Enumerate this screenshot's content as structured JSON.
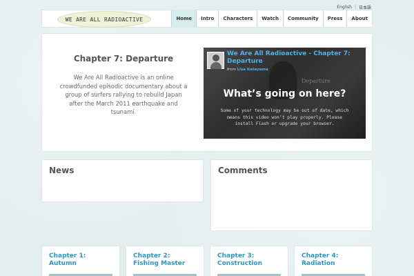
{
  "lang": {
    "english": "English",
    "separator": "|",
    "japanese": "日本語"
  },
  "header": {
    "logo_text": "WE ARE ALL  RADIOACTIVE",
    "nav": [
      {
        "label": "Home",
        "active": true
      },
      {
        "label": "Intro",
        "active": false
      },
      {
        "label": "Characters",
        "active": false
      },
      {
        "label": "Watch",
        "active": false
      },
      {
        "label": "Community",
        "active": false
      },
      {
        "label": "Press",
        "active": false
      },
      {
        "label": "About",
        "active": false
      }
    ]
  },
  "hero": {
    "title": "Chapter 7: Departure",
    "description": "We Are All Radioactive is an online crowdfunded episodic documentary about a group of surfers rallying to rebuild Japan after the March 2011 earthquake and tsunami."
  },
  "video": {
    "title": "We Are All Radioactive - Chapter 7: Departure",
    "byline_prefix": "from",
    "byline_author": "Lisa Katayama",
    "watermark": "Departure",
    "question": "What’s going on here?",
    "notice": "Some of your technology may be out of date, which means this video won’t play properly. Please install Flash or upgrade your browser."
  },
  "news": {
    "title": "News"
  },
  "comments": {
    "title": "Comments"
  },
  "chapters": [
    {
      "title_line1": "Chapter 1:",
      "title_line2": "Autumn"
    },
    {
      "title_line1": "Chapter 2:",
      "title_line2": "Fishing Master"
    },
    {
      "title_line1": "Chapter 3:",
      "title_line2": "Construction"
    },
    {
      "title_line1": "Chapter 4:",
      "title_line2": "Radiation"
    }
  ],
  "colors": {
    "accent": "#2b95c4",
    "video_title": "#4fb3ea",
    "nav_active": "#d7ecec"
  }
}
